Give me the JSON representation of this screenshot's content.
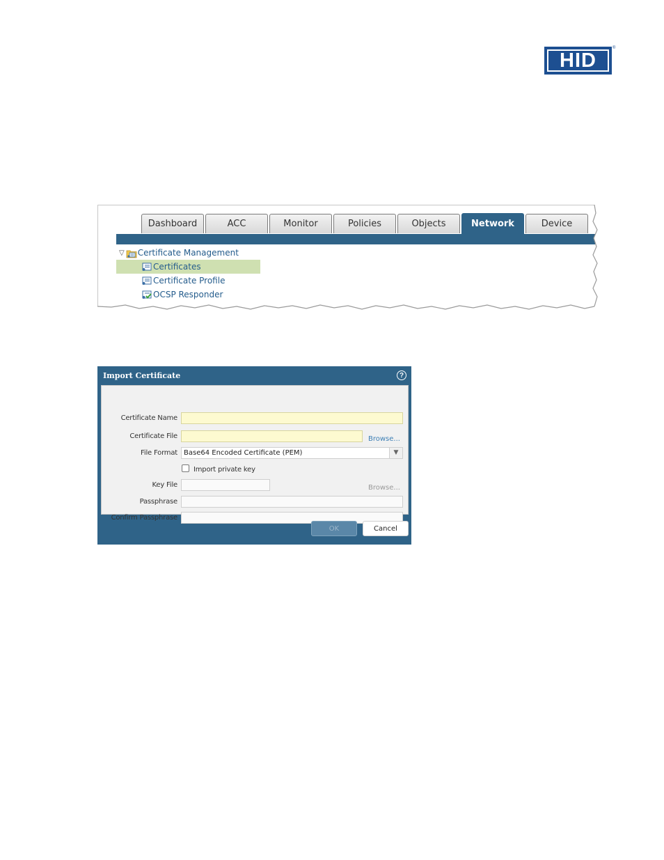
{
  "logo": {
    "text": "HID",
    "reg": "®"
  },
  "nav": {
    "tabs": [
      {
        "label": "Dashboard",
        "active": false
      },
      {
        "label": "ACC",
        "active": false
      },
      {
        "label": "Monitor",
        "active": false
      },
      {
        "label": "Policies",
        "active": false
      },
      {
        "label": "Objects",
        "active": false
      },
      {
        "label": "Network",
        "active": true
      },
      {
        "label": "Device",
        "active": false
      }
    ],
    "active_color": "#2f6388"
  },
  "tree": {
    "parent": {
      "label": "Certificate Management",
      "icon": "folder-certificate-icon"
    },
    "children": [
      {
        "label": "Certificates",
        "icon": "certificate-icon",
        "selected": true
      },
      {
        "label": "Certificate Profile",
        "icon": "certificate-profile-icon",
        "selected": false
      },
      {
        "label": "OCSP Responder",
        "icon": "ocsp-responder-icon",
        "selected": false
      }
    ]
  },
  "dialog": {
    "title": "Import Certificate",
    "fields": {
      "certificate_name": {
        "label": "Certificate Name",
        "value": ""
      },
      "certificate_file": {
        "label": "Certificate File",
        "value": "",
        "browse": "Browse..."
      },
      "file_format": {
        "label": "File Format",
        "value": "Base64 Encoded Certificate (PEM)"
      },
      "import_private_key": {
        "label": "Import private key",
        "checked": false
      },
      "key_file": {
        "label": "Key File",
        "value": "",
        "browse": "Browse..."
      },
      "passphrase": {
        "label": "Passphrase",
        "value": ""
      },
      "confirm_passphrase": {
        "label": "Confirm Passphrase",
        "value": ""
      }
    },
    "buttons": {
      "ok": "OK",
      "cancel": "Cancel"
    },
    "header_color": "#2f6388",
    "required_field_color": "#fdfad0"
  }
}
